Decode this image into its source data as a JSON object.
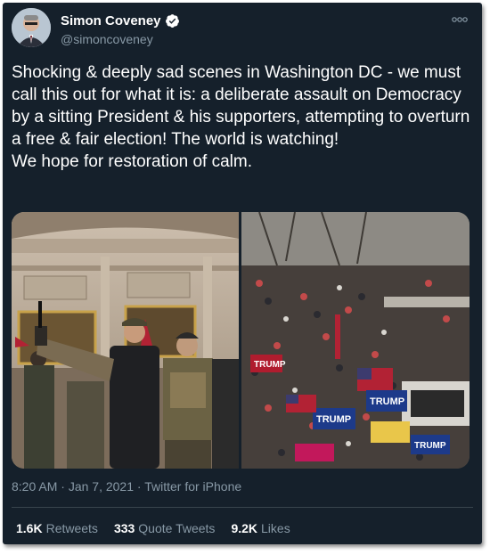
{
  "author": {
    "name": "Simon Coveney",
    "handle": "@simoncoveney",
    "verified": true
  },
  "tweet": {
    "text": "Shocking & deeply sad scenes in Washington DC - we must call this out for what it is: a deliberate assault on Democracy by a sitting President & his supporters, attempting to overturn a free & fair election! The world is watching!\nWe hope for restoration of calm."
  },
  "meta": {
    "time": "8:20 AM",
    "date": "Jan 7, 2021",
    "separator": "·",
    "source": "Twitter for iPhone"
  },
  "stats": [
    {
      "count": "1.6K",
      "label": "Retweets"
    },
    {
      "count": "333",
      "label": "Quote Tweets"
    },
    {
      "count": "9.2K",
      "label": "Likes"
    }
  ],
  "media": {
    "left_photo_signs": [],
    "right_photo_signs": [
      "TRUMP",
      "TRUMP",
      "TRUMP",
      "TRUMP"
    ]
  },
  "colors": {
    "background": "#15202b",
    "text": "#ffffff",
    "secondary": "#8899a6",
    "verified": "#1da1f2",
    "divider": "#38444d"
  },
  "icons": {
    "verified": "verified-badge-icon",
    "more": "more-options-icon"
  }
}
